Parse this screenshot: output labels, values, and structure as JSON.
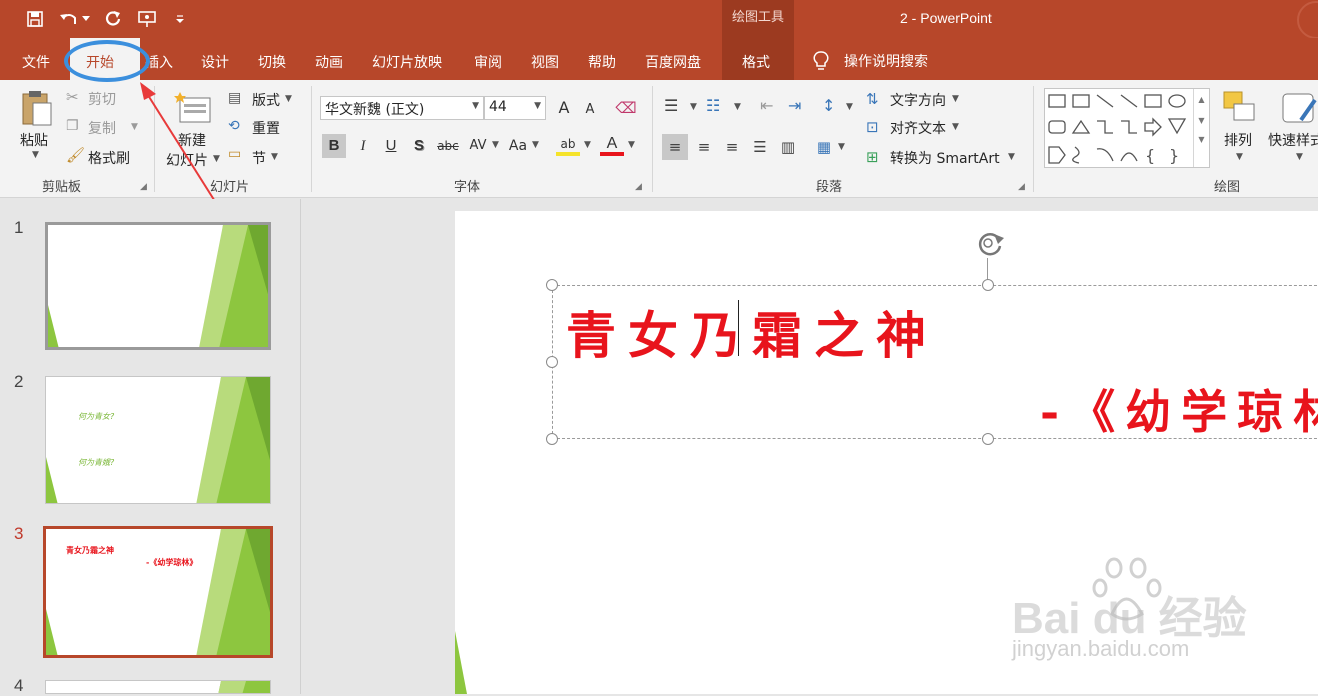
{
  "titlebar": {
    "context_group": "绘图工具",
    "doc_title": "2  -  PowerPoint"
  },
  "tabs": [
    "文件",
    "开始",
    "插入",
    "设计",
    "切换",
    "动画",
    "幻灯片放映",
    "审阅",
    "视图",
    "帮助",
    "百度网盘",
    "格式"
  ],
  "search": {
    "label": "操作说明搜索"
  },
  "clipboard": {
    "paste": "粘贴",
    "cut": "剪切",
    "copy": "复制",
    "format_painter": "格式刷",
    "group_label": "剪贴板"
  },
  "slides_group": {
    "new_slide_line1": "新建",
    "new_slide_line2": "幻灯片",
    "layout": "版式",
    "reset": "重置",
    "section": "节",
    "group_label": "幻灯片"
  },
  "font_group": {
    "font_name": "华文新魏 (正文)",
    "font_size": "44",
    "group_label": "字体",
    "bold": "B",
    "italic": "I",
    "underline": "U",
    "shadow": "S",
    "strike": "abc",
    "spacing": "AV",
    "case": "Aa",
    "highlight": "ab",
    "font_color": "A",
    "grow": "A",
    "shrink": "A"
  },
  "paragraph_group": {
    "text_direction": "文字方向",
    "align_text": "对齐文本",
    "smartart": "转换为 SmartArt",
    "group_label": "段落"
  },
  "drawing_group": {
    "arrange": "排列",
    "quick_styles": "快速样式",
    "group_label": "绘图"
  },
  "thumbnails": [
    {
      "number": "1",
      "lines": []
    },
    {
      "number": "2",
      "lines": [
        "何为青女?",
        "何为青娥?"
      ]
    },
    {
      "number": "3",
      "lines": [
        "青女乃霜之神",
        "-《幼学琼林》"
      ]
    },
    {
      "number": "4",
      "lines": []
    }
  ],
  "slide": {
    "title": "青女乃霜之神",
    "subtitle": "-《幼学琼林"
  },
  "watermark": {
    "brand": "Bai du 经验",
    "url": "jingyan.baidu.com"
  },
  "colors": {
    "accent": "#b7472a",
    "slide_text": "#e8141c",
    "thumb_green": "#8dc63f"
  }
}
